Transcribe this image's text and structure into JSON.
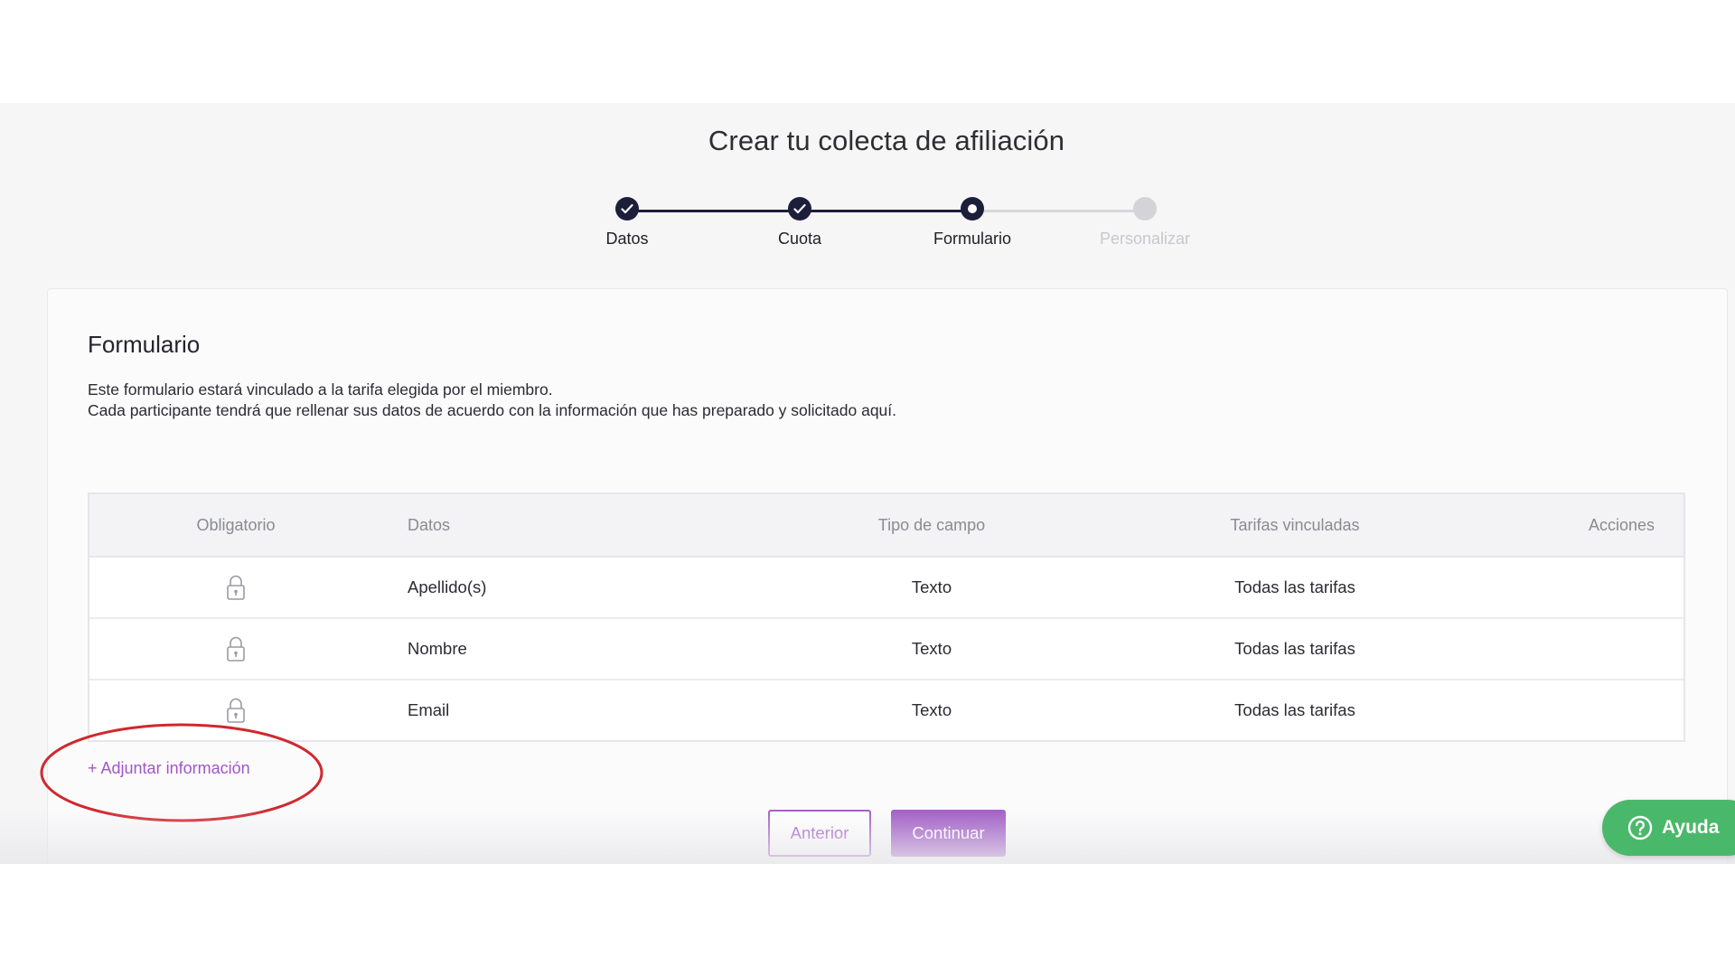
{
  "page": {
    "title": "Crear tu colecta de afiliación"
  },
  "stepper": {
    "steps": [
      {
        "label": "Datos",
        "state": "done"
      },
      {
        "label": "Cuota",
        "state": "done"
      },
      {
        "label": "Formulario",
        "state": "current"
      },
      {
        "label": "Personalizar",
        "state": "pending"
      }
    ]
  },
  "form": {
    "title": "Formulario",
    "description_line1": "Este formulario estará vinculado a la tarifa elegida por el miembro.",
    "description_line2": "Cada participante tendrá que rellenar sus datos de acuerdo con la información que has preparado y solicitado aquí.",
    "table": {
      "headers": {
        "obligatorio": "Obligatorio",
        "datos": "Datos",
        "tipo": "Tipo de campo",
        "tarifas": "Tarifas vinculadas",
        "acciones": "Acciones"
      },
      "rows": [
        {
          "required_icon": "lock-icon",
          "datos": "Apellido(s)",
          "tipo": "Texto",
          "tarifas": "Todas las tarifas"
        },
        {
          "required_icon": "lock-icon",
          "datos": "Nombre",
          "tipo": "Texto",
          "tarifas": "Todas las tarifas"
        },
        {
          "required_icon": "lock-icon",
          "datos": "Email",
          "tipo": "Texto",
          "tarifas": "Todas las tarifas"
        }
      ]
    },
    "add_link": "+ Adjuntar información"
  },
  "actions": {
    "prev_label": "Anterior",
    "next_label": "Continuar"
  },
  "help": {
    "label": "Ayuda",
    "icon": "question-circle-icon"
  },
  "colors": {
    "accent": "#a35fc7",
    "stepper_active": "#1d1e3a",
    "help_green": "#4ab86a",
    "annotation_red": "#d0282e"
  }
}
